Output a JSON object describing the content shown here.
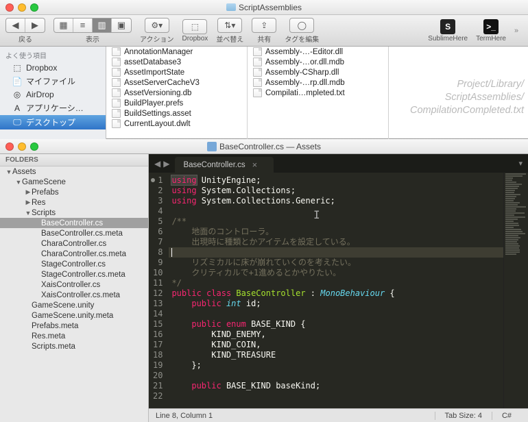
{
  "finder": {
    "window_title": "ScriptAssemblies",
    "back_label": "戻る",
    "toolbar": {
      "view_label": "表示",
      "action_label": "アクション",
      "dropbox_label": "Dropbox",
      "sort_label": "並べ替え",
      "share_label": "共有",
      "tags_label": "タグを編集",
      "sublime_label": "SublimeHere",
      "term_label": "TermHere",
      "sublime_glyph": "S",
      "term_glyph": ">_"
    },
    "sidebar_header": "よく使う項目",
    "sidebar_items": [
      {
        "label": "Dropbox",
        "icon": "⬚"
      },
      {
        "label": "マイファイル",
        "icon": "📄"
      },
      {
        "label": "AirDrop",
        "icon": "◎"
      },
      {
        "label": "アプリケーシ…",
        "icon": "A"
      },
      {
        "label": "デスクトップ",
        "icon": "🖵"
      }
    ],
    "col1": [
      "AnnotationManager",
      "assetDatabase3",
      "AssetImportState",
      "AssetServerCacheV3",
      "AssetVersioning.db",
      "BuildPlayer.prefs",
      "BuildSettings.asset",
      "CurrentLayout.dwlt"
    ],
    "col2": [
      "Assembly-…-Editor.dll",
      "Assembly-…or.dll.mdb",
      "Assembly-CSharp.dll",
      "Assembly-…rp.dll.mdb",
      "Compilati…mpleted.txt"
    ],
    "watermark": [
      "Project/Library/",
      "ScriptAssemblies/",
      "CompilationCompleted.txt"
    ]
  },
  "sublime": {
    "window_title": "BaseController.cs — Assets",
    "sidebar_header": "FOLDERS",
    "tab_title": "BaseController.cs",
    "tree": {
      "root": "Assets",
      "gamescene": "GameScene",
      "prefabs": "Prefabs",
      "res": "Res",
      "scripts": "Scripts",
      "files": [
        "BaseController.cs",
        "BaseController.cs.meta",
        "CharaController.cs",
        "CharaController.cs.meta",
        "StageController.cs",
        "StageController.cs.meta",
        "XaisController.cs",
        "XaisController.cs.meta"
      ],
      "tail": [
        "GameScene.unity",
        "GameScene.unity.meta",
        "Prefabs.meta",
        "Res.meta",
        "Scripts.meta"
      ]
    },
    "code": {
      "l1_kw": "using",
      "l1_ns": " UnityEngine;",
      "l2": " System.Collections;",
      "l3": " System.Collections.Generic;",
      "l5": "/**",
      "l6": "    地面のコントローラ。",
      "l7": "    出現時に種類とかアイテムを設定している。",
      "l9": "    リズミカルに床が崩れていくのを考えたい。",
      "l10": "    クリティカルで+1進めるとかやりたい。",
      "l11": "*/",
      "public": "public",
      "class": "class",
      "cls": "BaseController",
      "mono": "MonoBehaviour",
      "int": "int",
      "id": " id;",
      "enum": "enum",
      "enum_name": " BASE_KIND {",
      "k1": "KIND_ENEMY,",
      "k2": "KIND_COIN,",
      "k3": "KIND_TREASURE",
      "close": "};",
      "bk": " BASE_KIND baseKind;"
    },
    "status": {
      "pos": "Line 8, Column 1",
      "tab": "Tab Size: 4",
      "lang": "C#"
    }
  }
}
